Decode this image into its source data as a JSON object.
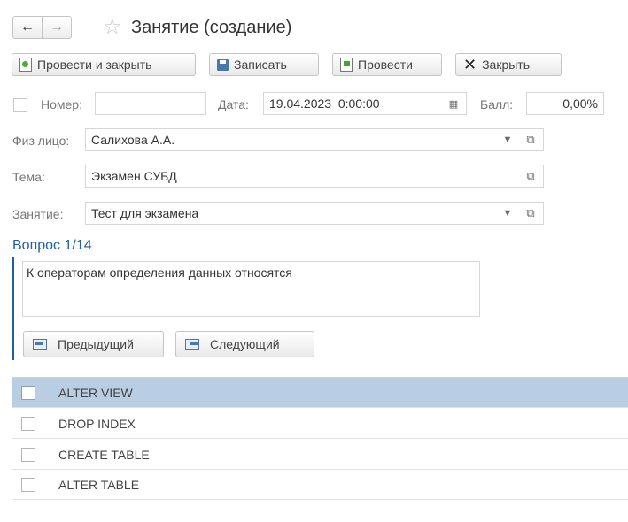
{
  "window": {
    "title": "Занятие (создание)"
  },
  "toolbar": {
    "post_close": "Провести и закрыть",
    "save": "Записать",
    "post": "Провести",
    "close": "Закрыть"
  },
  "header": {
    "number_label": "Номер:",
    "number_value": "",
    "date_label": "Дата:",
    "date_value": "19.04.2023  0:00:00",
    "score_label": "Балл:",
    "score_value": "0,00%"
  },
  "form": {
    "person_label": "Физ лицо:",
    "person_value": "Салихова А.А.",
    "topic_label": "Тема:",
    "topic_value": "Экзамен СУБД",
    "lesson_label": "Занятие:",
    "lesson_value": "Тест для экзамена"
  },
  "question": {
    "title": "Вопрос 1/14",
    "text": "К операторам определения данных относятся",
    "prev": "Предыдущий",
    "next": "Следующий"
  },
  "answers": [
    {
      "text": "ALTER VIEW",
      "checked": false,
      "selected": true
    },
    {
      "text": "DROP INDEX",
      "checked": false,
      "selected": false
    },
    {
      "text": "CREATE TABLE",
      "checked": false,
      "selected": false
    },
    {
      "text": "ALTER TABLE",
      "checked": false,
      "selected": false
    }
  ],
  "colors": {
    "accent": "#1f5fa8",
    "selected_row": "#b9cde3"
  }
}
